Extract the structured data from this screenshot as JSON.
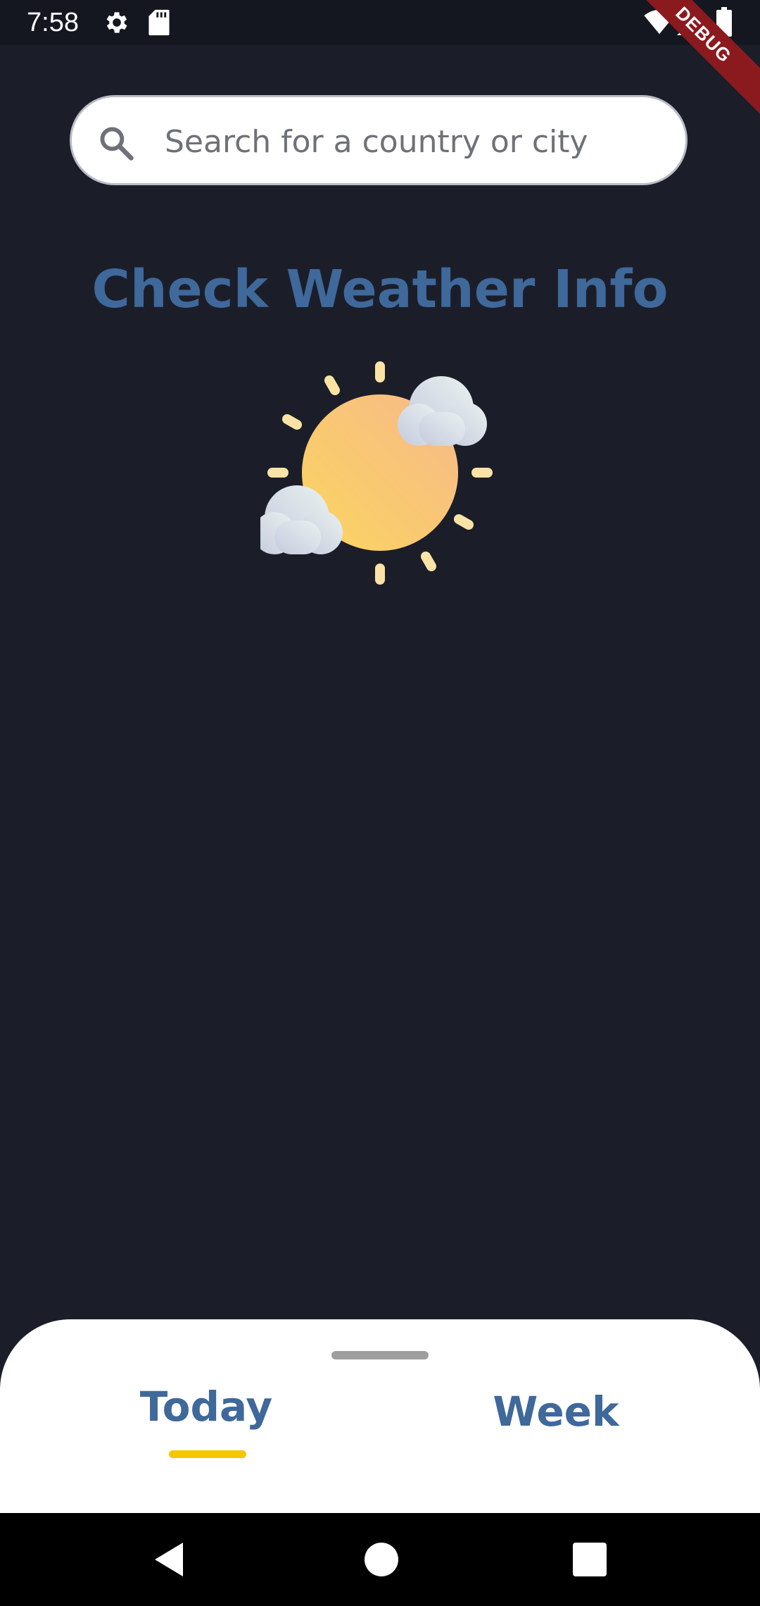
{
  "status_bar": {
    "time": "7:58",
    "icons": [
      "gear-icon",
      "sd-card-icon",
      "wifi-icon",
      "signal-icon",
      "battery-icon"
    ],
    "debug_label": "DEBUG"
  },
  "search": {
    "placeholder": "Search for a country or city",
    "value": ""
  },
  "main": {
    "title": "Check Weather Info",
    "illustration": "sun-with-clouds-icon"
  },
  "bottom_sheet": {
    "tabs": [
      {
        "label": "Today",
        "selected": true
      },
      {
        "label": "Week",
        "selected": false
      }
    ]
  },
  "nav_bar": {
    "buttons": [
      "back-icon",
      "home-icon",
      "recents-icon"
    ]
  },
  "colors": {
    "background": "#1b1e29",
    "accent": "#3f689b",
    "indicator": "#f7c600",
    "debug_banner": "#8b1a1f"
  }
}
